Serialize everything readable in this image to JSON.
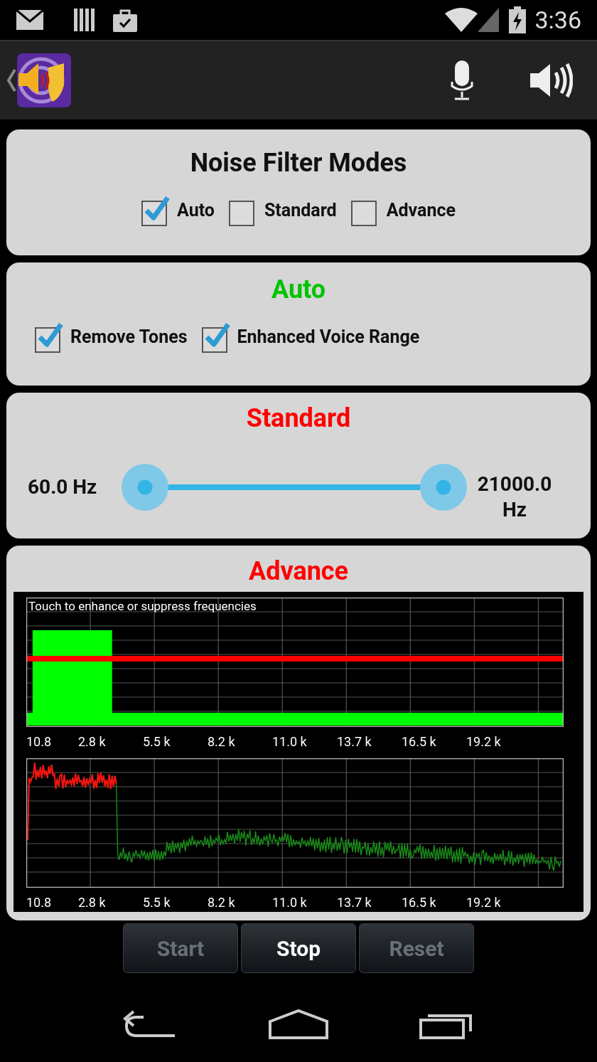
{
  "status_bar": {
    "time": "3:36"
  },
  "modes": {
    "title": "Noise Filter Modes",
    "options": [
      {
        "label": "Auto",
        "checked": true
      },
      {
        "label": "Standard",
        "checked": false
      },
      {
        "label": "Advance",
        "checked": false
      }
    ]
  },
  "auto": {
    "title": "Auto",
    "active": true,
    "options": [
      {
        "label": "Remove Tones",
        "checked": true
      },
      {
        "label": "Enhanced Voice Range",
        "checked": true
      }
    ]
  },
  "standard": {
    "title": "Standard",
    "active": false,
    "low": "60.0 Hz",
    "high": "21000.0 Hz",
    "thumbs": [
      {
        "level": 0
      },
      {
        "level": 1
      }
    ]
  },
  "advance": {
    "title": "Advance",
    "active": false,
    "hint": "Touch to enhance or suppress frequencies",
    "graphs": [
      {
        "kind": "filter",
        "x_labels": [
          "10.8",
          "2.8 k",
          "5.5 k",
          "8.2 k",
          "11.0 k",
          "13.7 k",
          "16.5 k",
          "19.2 k"
        ]
      },
      {
        "kind": "spectrum",
        "x_labels": [
          "10.8",
          "2.8 k",
          "5.5 k",
          "8.2 k",
          "11.0 k",
          "13.7 k",
          "16.5 k",
          "19.2 k"
        ]
      }
    ]
  },
  "buttons": [
    {
      "label": "Start",
      "disabled": true
    },
    {
      "label": "Stop",
      "disabled": false
    },
    {
      "label": "Reset",
      "disabled": true
    }
  ]
}
